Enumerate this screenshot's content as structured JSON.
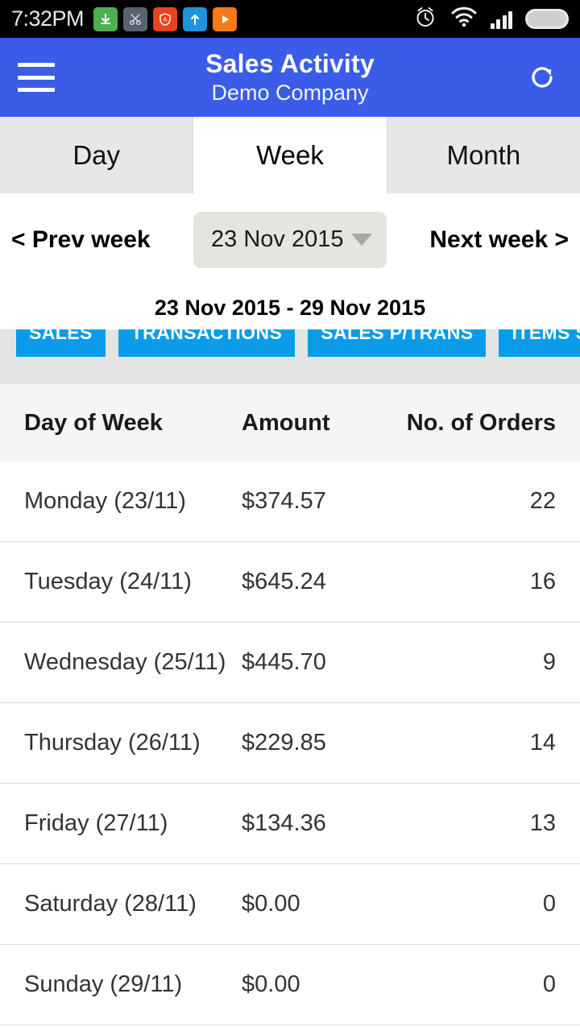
{
  "statusbar": {
    "time": "7:32PM",
    "left_icons": [
      {
        "name": "download-icon",
        "color": "#4caf50"
      },
      {
        "name": "scissors-icon",
        "color": "#5a6270"
      },
      {
        "name": "shield-a-icon",
        "color": "#e8431f"
      },
      {
        "name": "upload-icon",
        "color": "#1e94e0"
      },
      {
        "name": "play-icon",
        "color": "#f47b15"
      }
    ],
    "right_icons": [
      "alarm-icon",
      "wifi-icon",
      "signal-icon",
      "battery-icon"
    ]
  },
  "appbar": {
    "title": "Sales Activity",
    "subtitle": "Demo Company",
    "menu_icon": "hamburger-icon",
    "refresh_icon": "refresh-icon",
    "background": "#3a5ce8"
  },
  "tabs": [
    {
      "label": "Day",
      "active": false
    },
    {
      "label": "Week",
      "active": true
    },
    {
      "label": "Month",
      "active": false
    }
  ],
  "datenav": {
    "prev_label": "< Prev week",
    "next_label": "Next week >",
    "selected_date": "23 Nov 2015"
  },
  "range_label": "23 Nov 2015 - 29 Nov 2015",
  "metric_chips": {
    "accent": "#0a9ce8",
    "items": [
      "SALES",
      "TRANSACTIONS",
      "SALES P/TRANS",
      "ITEMS SOLD"
    ]
  },
  "table": {
    "headers": [
      "Day of Week",
      "Amount",
      "No. of Orders"
    ],
    "rows": [
      {
        "day": "Monday (23/11)",
        "amount": "$374.57",
        "orders": "22"
      },
      {
        "day": "Tuesday (24/11)",
        "amount": "$645.24",
        "orders": "16"
      },
      {
        "day": "Wednesday (25/11)",
        "amount": "$445.70",
        "orders": "9"
      },
      {
        "day": "Thursday (26/11)",
        "amount": "$229.85",
        "orders": "14"
      },
      {
        "day": "Friday (27/11)",
        "amount": "$134.36",
        "orders": "13"
      },
      {
        "day": "Saturday (28/11)",
        "amount": "$0.00",
        "orders": "0"
      },
      {
        "day": "Sunday (29/11)",
        "amount": "$0.00",
        "orders": "0"
      }
    ]
  }
}
